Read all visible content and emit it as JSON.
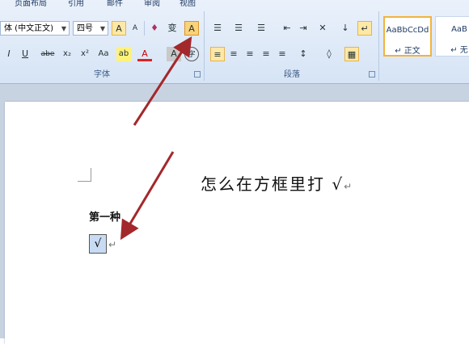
{
  "ribbon": {
    "tabs": [
      "页面布局",
      "引用",
      "邮件",
      "审阅",
      "视图"
    ],
    "font": {
      "font_name": "体 (中文正文)",
      "font_size": "四号",
      "group_label": "字体",
      "buttons": {
        "grow": "A",
        "shrink": "A",
        "clear": "♦",
        "phonetic": "变",
        "char_border": "A",
        "italic": "I",
        "underline": "U",
        "strike": "abe",
        "subscript": "x₂",
        "superscript": "x²",
        "change_case": "Aa",
        "highlight": "ab",
        "font_color": "A",
        "char_shading": "A",
        "enclose": "字"
      }
    },
    "paragraph": {
      "group_label": "段落",
      "buttons": {
        "bullets": "☰",
        "numbering": "☰",
        "multilevel": "☰",
        "decrease_indent": "⇤",
        "increase_indent": "⇥",
        "chinese_layout": "✕",
        "sort": "↓",
        "show_marks": "↵",
        "align_left": "≡",
        "center": "≡",
        "align_right": "≡",
        "justify": "≡",
        "distributed": "≡",
        "line_spacing": "↕",
        "shading": "◊",
        "borders": "▦"
      }
    },
    "styles": [
      {
        "preview": "AaBbCcDd",
        "name": "↵ 正文"
      },
      {
        "preview": "AaB",
        "name": "↵ 无"
      }
    ]
  },
  "document": {
    "title": "怎么在方框里打 √",
    "paragraph_mark": "↵",
    "method_label": "第一种",
    "check_char": "√"
  },
  "colors": {
    "ribbon_top": "#eaf1fb",
    "ribbon_bottom": "#d6e4f5",
    "arrow": "#a3282b",
    "highlight": "#fde8a6"
  }
}
